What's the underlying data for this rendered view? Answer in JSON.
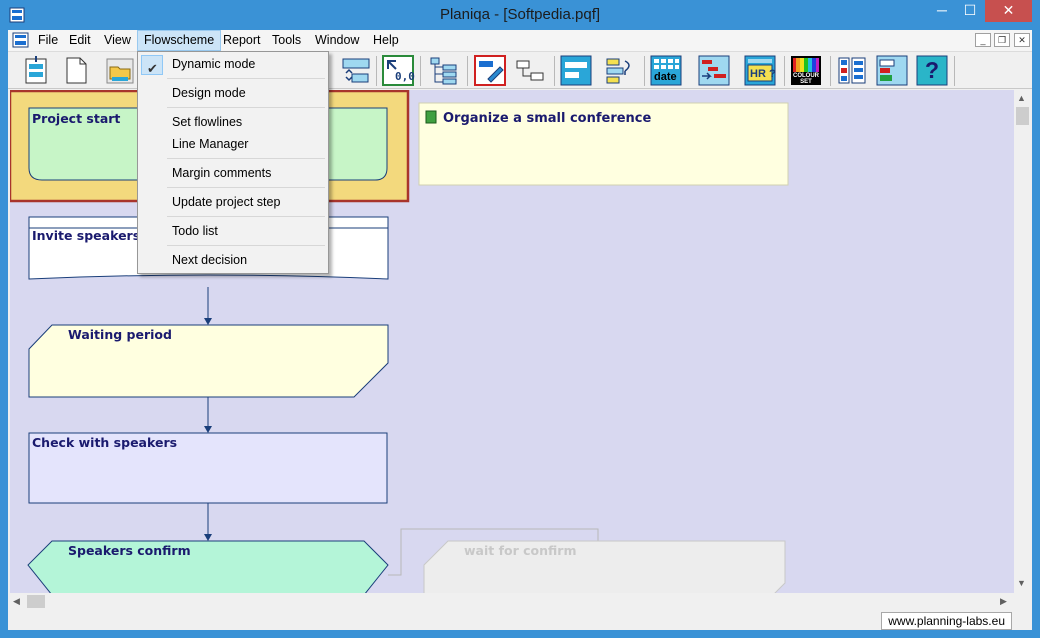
{
  "window": {
    "title": "Planiqa - [Softpedia.pqf]",
    "controls": {
      "minimize": "─",
      "maximize": "☐",
      "close": "✕"
    }
  },
  "menubar": {
    "items": [
      "File",
      "Edit",
      "View",
      "Flowscheme",
      "Report",
      "Tools",
      "Window",
      "Help"
    ],
    "mdi": {
      "minimize": "_",
      "restore": "❐",
      "close": "✕"
    }
  },
  "toolbar": {
    "icons": [
      "new-step-icon",
      "new-document-icon",
      "open-folder-icon",
      "link-icon",
      "move-step-icon",
      "coordinates-icon",
      "tree-structure-icon",
      "edit-step-icon",
      "connector-icon",
      "timeline-icon",
      "sort-steps-icon",
      "date-icon",
      "gantt-icon",
      "hr-icon",
      "colour-set-icon",
      "layout-icon",
      "layout-alt-icon",
      "help-icon"
    ],
    "date_label": "date",
    "hr_label": "HR ?",
    "coords_label": "0,0",
    "colour_label": "COLOUR SET",
    "help_label": "?"
  },
  "flowscheme_menu": {
    "items": [
      {
        "label": "Dynamic mode",
        "checked": true
      },
      {
        "label": "Design mode"
      },
      {
        "label": "Set flowlines"
      },
      {
        "label": "Line Manager"
      },
      {
        "label": "Margin comments"
      },
      {
        "label": "Update project step"
      },
      {
        "label": "Todo list"
      },
      {
        "label": "Next decision"
      }
    ]
  },
  "flowchart": {
    "project_title": "Organize a small conference",
    "steps": [
      {
        "label": "Project start",
        "color": "#c7f5c7"
      },
      {
        "label": "Invite speakers",
        "color": "#ffffff"
      },
      {
        "label": "Waiting period",
        "color": "#ffffe0"
      },
      {
        "label": "Check with speakers",
        "color": "#e4e4fc"
      },
      {
        "label": "Speakers confirm",
        "color": "#b4f5d8"
      },
      {
        "label": "wait for confirm",
        "color": "#ededed"
      }
    ],
    "canvas_color": "#d8d8f0",
    "highlight_color": "#f3d97d",
    "highlight_border": "#a8342c"
  },
  "statusbar": {
    "url": "www.planning-labs.eu"
  },
  "scrollbars": {
    "up": "▲",
    "down": "▼",
    "left": "◀",
    "right": "▶"
  }
}
